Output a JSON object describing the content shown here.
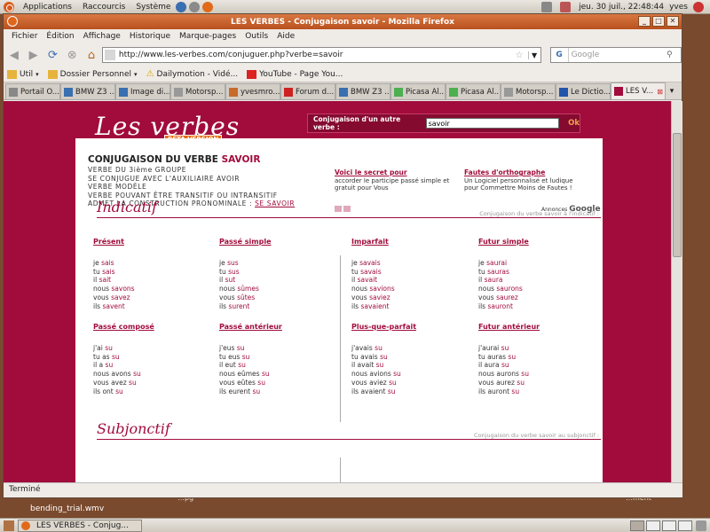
{
  "top_panel": {
    "menus": [
      "Applications",
      "Raccourcis",
      "Système"
    ],
    "clock": "jeu. 30 juil., 22:48:44",
    "user": "yves"
  },
  "desktop": {
    "file_label": "bending_trial.wmv",
    "partial_label_1": "…pg",
    "partial_label_2": "…ment"
  },
  "window": {
    "title": "LES VERBES - Conjugaison savoir - Mozilla Firefox",
    "buttons": [
      "_",
      "□",
      "✕"
    ]
  },
  "menubar": [
    "Fichier",
    "Édition",
    "Affichage",
    "Historique",
    "Marque-pages",
    "Outils",
    "Aide"
  ],
  "navbar": {
    "url": "http://www.les-verbes.com/conjuguer.php?verbe=savoir",
    "search_placeholder": "Google"
  },
  "bookmarks": [
    {
      "label": "Util",
      "icon": "folder-icon"
    },
    {
      "label": "Dossier Personnel",
      "icon": "folder-icon"
    },
    {
      "label": "Dailymotion - Vidé...",
      "icon": "warning-icon"
    },
    {
      "label": "YouTube - Page You...",
      "icon": "youtube-icon"
    }
  ],
  "tabs": [
    {
      "label": "Portail O...",
      "color": "#888888"
    },
    {
      "label": "BMW Z3 ...",
      "color": "#3a6fb0"
    },
    {
      "label": "Image di...",
      "color": "#3a6fb0"
    },
    {
      "label": "Motorsp...",
      "color": "#999999"
    },
    {
      "label": "yvesmro...",
      "color": "#c86a2a"
    },
    {
      "label": "Forum d...",
      "color": "#cc2222"
    },
    {
      "label": "BMW Z3 ...",
      "color": "#3a6fb0"
    },
    {
      "label": "Picasa Al...",
      "color": "#4caf50"
    },
    {
      "label": "Picasa Al...",
      "color": "#4caf50"
    },
    {
      "label": "Motorsp...",
      "color": "#999999"
    },
    {
      "label": "Le Dictio...",
      "color": "#2255aa"
    },
    {
      "label": "LES V...",
      "color": "#a10c3c",
      "active": true
    }
  ],
  "site": {
    "logo": "Les verbes",
    "beta": "BETA VERSION",
    "conj_label": "Conjugaison d'un autre verbe :",
    "conj_value": "savoir",
    "conj_button": "Ok",
    "verb_title_prefix": "CONJUGAISON DU VERBE",
    "verb": "SAVOIR",
    "info": [
      "VERBE DU 3ième GROUPE",
      "SE CONJUGUE AVEC L'AUXILIAIRE AVOIR",
      "VERBE MODÈLE",
      "VERBE POUVANT ÊTRE TRANSITIF OU INTRANSITIF"
    ],
    "info_pronominal": "ADMET LA CONSTRUCTION PRONOMINALE :",
    "info_link": "SE SAVOIR",
    "ads": [
      {
        "title": "Voici le secret pour",
        "body": "accorder le participe passé simple et gratuit pour Vous"
      },
      {
        "title": "Fautes d'orthographe",
        "body": "Un Logiciel personnalisé et ludique pour Commettre Moins de Fautes !"
      }
    ],
    "ads_by": "Annonces",
    "ads_brand": "Google",
    "indicatif_title": "Indicatif",
    "indicatif_note": "Conjugaison du verbe savoir à l'indicatif :",
    "subjonctif_title": "Subjonctif",
    "subjonctif_note": "Conjugaison du verbe savoir au subjonctif :",
    "tenses": [
      {
        "name": "Présent",
        "rows": [
          [
            "je ",
            "sais"
          ],
          [
            "tu ",
            "sais"
          ],
          [
            "il ",
            "sait"
          ],
          [
            "nous ",
            "savons"
          ],
          [
            "vous ",
            "savez"
          ],
          [
            "ils ",
            "savent"
          ]
        ]
      },
      {
        "name": "Passé simple",
        "rows": [
          [
            "je ",
            "sus"
          ],
          [
            "tu ",
            "sus"
          ],
          [
            "il ",
            "sut"
          ],
          [
            "nous ",
            "sûmes"
          ],
          [
            "vous ",
            "sûtes"
          ],
          [
            "ils ",
            "surent"
          ]
        ]
      },
      {
        "name": "Imparfait",
        "rows": [
          [
            "je ",
            "savais"
          ],
          [
            "tu ",
            "savais"
          ],
          [
            "il ",
            "savait"
          ],
          [
            "nous ",
            "savions"
          ],
          [
            "vous ",
            "saviez"
          ],
          [
            "ils ",
            "savaient"
          ]
        ]
      },
      {
        "name": "Futur simple",
        "rows": [
          [
            "je ",
            "saurai"
          ],
          [
            "tu ",
            "sauras"
          ],
          [
            "il ",
            "saura"
          ],
          [
            "nous ",
            "saurons"
          ],
          [
            "vous ",
            "saurez"
          ],
          [
            "ils ",
            "sauront"
          ]
        ]
      },
      {
        "name": "Passé composé",
        "rows": [
          [
            "j'ai ",
            "su"
          ],
          [
            "tu as ",
            "su"
          ],
          [
            "il a ",
            "su"
          ],
          [
            "nous avons ",
            "su"
          ],
          [
            "vous avez ",
            "su"
          ],
          [
            "ils ont ",
            "su"
          ]
        ]
      },
      {
        "name": "Passé antérieur",
        "rows": [
          [
            "j'eus ",
            "su"
          ],
          [
            "tu eus ",
            "su"
          ],
          [
            "il eut ",
            "su"
          ],
          [
            "nous eûmes ",
            "su"
          ],
          [
            "vous eûtes ",
            "su"
          ],
          [
            "ils eurent ",
            "su"
          ]
        ]
      },
      {
        "name": "Plus-que-parfait",
        "rows": [
          [
            "j'avais ",
            "su"
          ],
          [
            "tu avais ",
            "su"
          ],
          [
            "il avait ",
            "su"
          ],
          [
            "nous avions ",
            "su"
          ],
          [
            "vous aviez ",
            "su"
          ],
          [
            "ils avaient ",
            "su"
          ]
        ]
      },
      {
        "name": "Futur antérieur",
        "rows": [
          [
            "j'aurai ",
            "su"
          ],
          [
            "tu auras ",
            "su"
          ],
          [
            "il aura ",
            "su"
          ],
          [
            "nous aurons ",
            "su"
          ],
          [
            "vous aurez ",
            "su"
          ],
          [
            "ils auront ",
            "su"
          ]
        ]
      }
    ]
  },
  "statusbar": "Terminé",
  "taskbar": {
    "task": "LES VERBES - Conjug..."
  }
}
